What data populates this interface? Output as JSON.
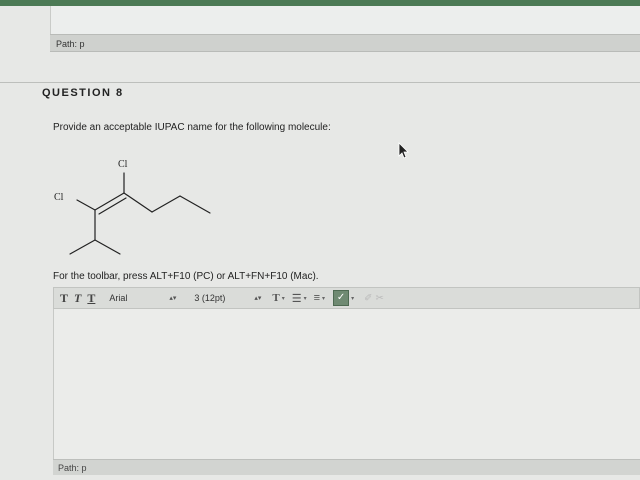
{
  "top_editor": {
    "path_label": "Path: p"
  },
  "question": {
    "title": "QUESTION 8",
    "prompt": "Provide an acceptable IUPAC name for the following molecule:"
  },
  "molecule": {
    "atom_label_top": "Cl",
    "atom_label_left": "Cl"
  },
  "editor": {
    "toolbar_hint": "For the toolbar, press ALT+F10 (PC) or ALT+FN+F10 (Mac).",
    "font_family": "Arial",
    "font_size": "3 (12pt)",
    "path_label": "Path: p"
  },
  "colors": {
    "accent_strip": "#4c7a55",
    "spellcheck": "#6f8a72"
  },
  "icons": [
    "bold-icon",
    "italic-icon",
    "underline-icon",
    "text-color-icon",
    "bullet-list-icon",
    "numbered-list-icon",
    "spellcheck-icon",
    "link-icon",
    "unlink-icon",
    "cursor-arrow-icon"
  ]
}
